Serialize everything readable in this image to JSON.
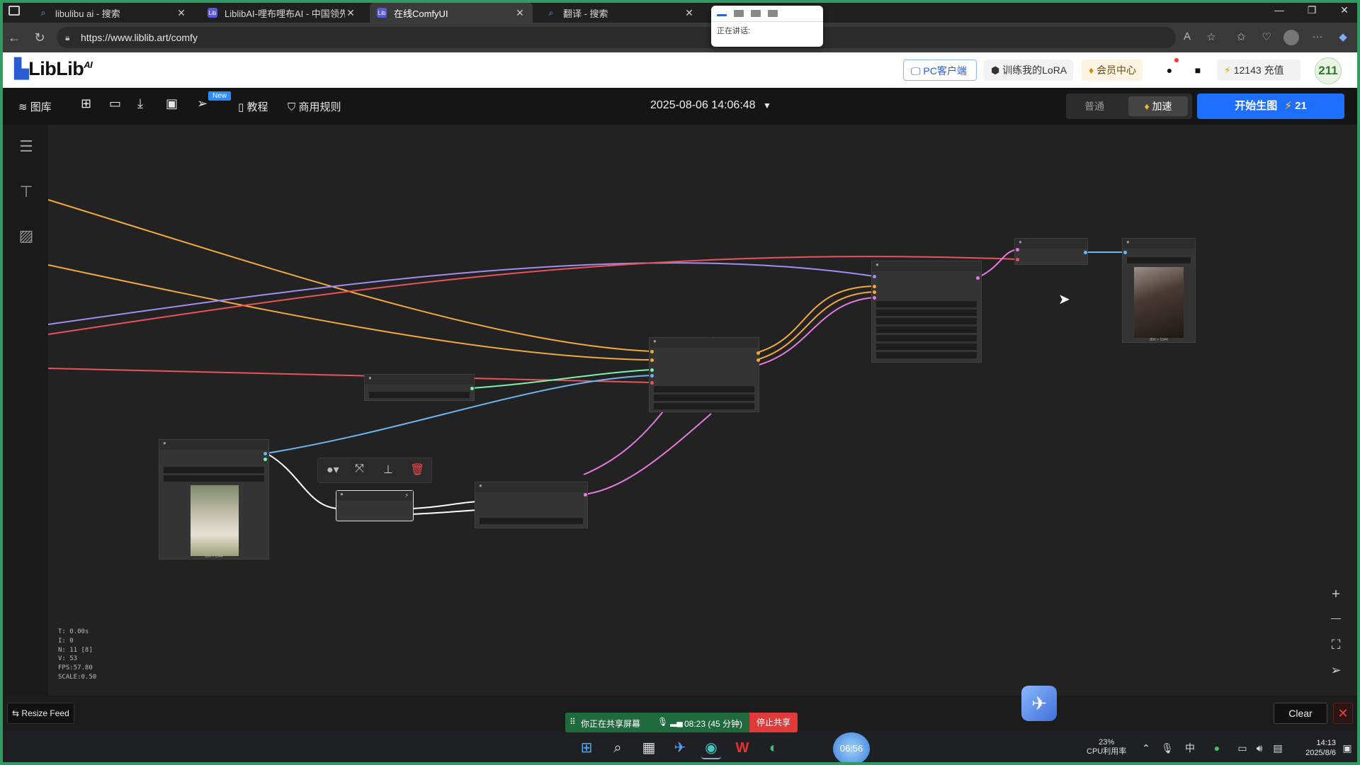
{
  "browser": {
    "tabs": [
      {
        "title": "libulibu ai - 搜索",
        "active": false
      },
      {
        "title": "LiblibAI-哩布哩布AI - 中国领先的",
        "active": false
      },
      {
        "title": "在线ComfyUI",
        "active": true
      },
      {
        "title": "翻译 - 搜索",
        "active": false
      }
    ],
    "url": "https://www.liblib.art/comfy",
    "popup_label": "正在讲话:"
  },
  "header": {
    "logo_text": "LibLib",
    "logo_sup": "AI",
    "pc_client": "PC客户端",
    "train_lora": "训练我的LoRA",
    "member_center": "会员中心",
    "credits": "12143",
    "recharge": "充值",
    "user_badge": "211"
  },
  "toolbar": {
    "gallery": "图库",
    "new_badge": "New",
    "tutorial": "教程",
    "commercial_rules": "商用规则",
    "datetime": "2025-08-06 14:06:48",
    "mode_normal": "普通",
    "mode_fast": "加速",
    "start_label": "开始生图",
    "start_cost": "21"
  },
  "canvas": {
    "stats": [
      "T: 0.00s",
      "I: 0",
      "N: 11 [8]",
      "V: 53",
      "FPS:57.80",
      "SCALE:0.50"
    ],
    "zoom_in": "+",
    "zoom_out": "—",
    "image_caption_1": "896 × 1344",
    "image_caption_2": "896 × 1344"
  },
  "bottom": {
    "resize_feed": "Resize Feed",
    "clear": "Clear",
    "sharing_text": "你正在共享屏幕",
    "share_time": "08:23 (45 分钟)",
    "stop_share": "停止共享"
  },
  "taskbar": {
    "timer": "06:56",
    "cpu_pct": "23%",
    "cpu_label": "CPU利用率",
    "ime": "中",
    "time": "14:13",
    "date": "2025/8/6"
  },
  "colors": {
    "accent_blue": "#1f6fff",
    "wire_orange": "#f0a93c",
    "wire_purple": "#a48cf0",
    "wire_red": "#e8525a",
    "wire_blue": "#6fb6f0",
    "wire_green": "#7ff0b0",
    "wire_pink": "#e37be0",
    "share_green": "#1e6a3d",
    "stop_red": "#e03a3a"
  }
}
